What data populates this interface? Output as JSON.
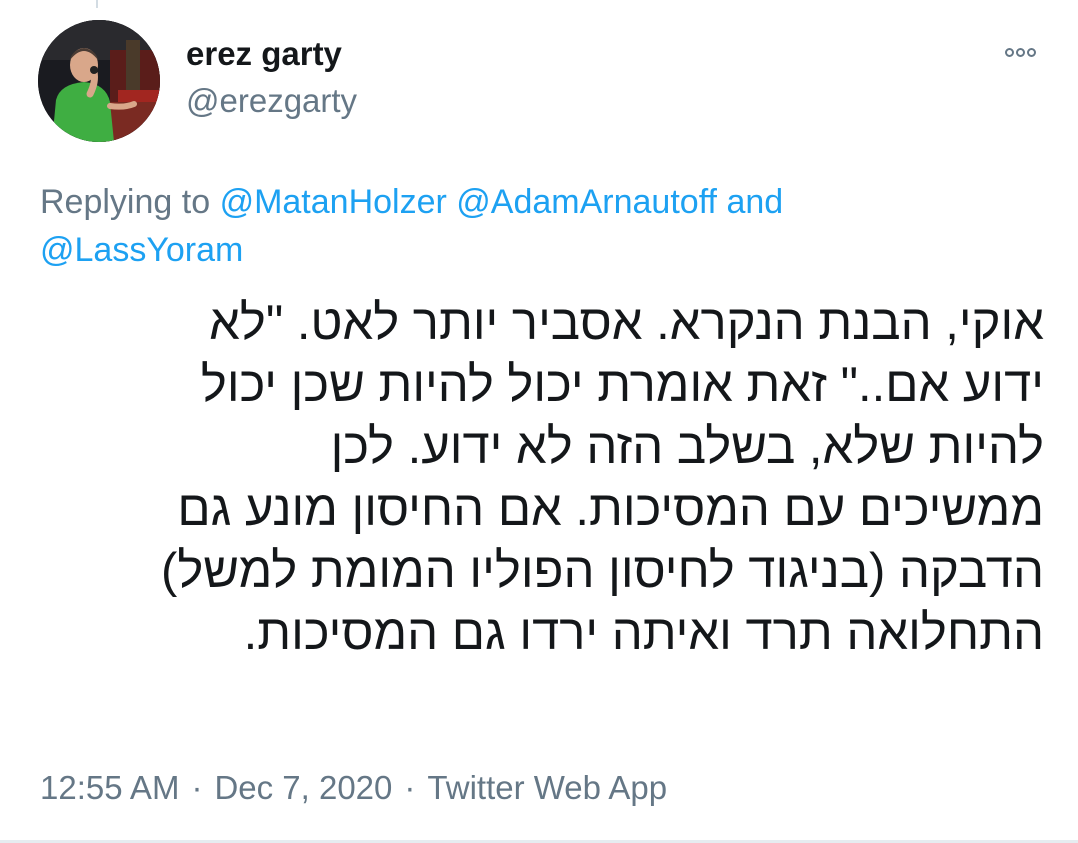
{
  "user": {
    "display_name": "erez garty",
    "handle": "@erezgarty"
  },
  "more_icon": "more-horizontal-icon",
  "reply": {
    "prefix": "Replying to",
    "mentions": [
      "@MatanHolzer",
      "@AdamArnautoff",
      "@LassYoram"
    ],
    "joiner": "and"
  },
  "tweet": {
    "lines": [
      "אוקי, הבנת הנקרא. אסביר יותר לאט. \"לא",
      "ידוע אם..\" זאת אומרת יכול להיות שכן יכול",
      "להיות שלא, בשלב הזה לא ידוע. לכן",
      "ממשיכים עם המסיכות. אם החיסון מונע גם",
      "הדבקה (בניגוד לחיסון הפוליו המומת למשל)",
      "התחלואה תרד ואיתה ירדו גם המסיכות."
    ]
  },
  "meta": {
    "time": "12:55 AM",
    "date": "Dec 7, 2020",
    "source": "Twitter Web App",
    "separator": "·"
  },
  "colors": {
    "text": "#14171a",
    "secondary": "#657786",
    "link": "#1da1f2"
  }
}
